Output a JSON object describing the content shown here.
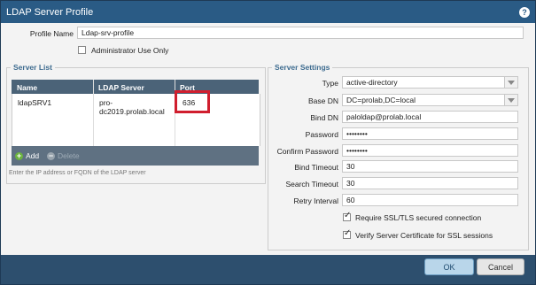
{
  "dialog": {
    "title": "LDAP Server Profile",
    "help_icon": "help-icon"
  },
  "profile": {
    "name_label": "Profile Name",
    "name_value": "Ldap-srv-profile",
    "admin_only_label": "Administrator Use Only",
    "admin_only_checked": false
  },
  "server_list": {
    "legend": "Server List",
    "columns": [
      "Name",
      "LDAP Server",
      "Port"
    ],
    "rows": [
      {
        "name": "ldapSRV1",
        "server_line1": "pro-",
        "server_line2": "dc2019.prolab.local",
        "port": "636"
      }
    ],
    "add_label": "Add",
    "delete_label": "Delete",
    "hint": "Enter the IP address or FQDN of the LDAP server"
  },
  "settings": {
    "legend": "Server Settings",
    "type_label": "Type",
    "type_value": "active-directory",
    "base_dn_label": "Base DN",
    "base_dn_value": "DC=prolab,DC=local",
    "bind_dn_label": "Bind DN",
    "bind_dn_value": "paloldap@prolab.local",
    "password_label": "Password",
    "password_value": "••••••••",
    "confirm_label": "Confirm Password",
    "confirm_value": "••••••••",
    "bind_timeout_label": "Bind Timeout",
    "bind_timeout_value": "30",
    "search_timeout_label": "Search Timeout",
    "search_timeout_value": "30",
    "retry_label": "Retry Interval",
    "retry_value": "60",
    "ssl_label": "Require SSL/TLS secured connection",
    "ssl_checked": true,
    "verify_label": "Verify Server Certificate for SSL sessions",
    "verify_checked": true
  },
  "buttons": {
    "ok": "OK",
    "cancel": "Cancel"
  },
  "colors": {
    "title_bar": "#2a5b85",
    "highlight": "#d01e2e",
    "grid_header": "#4b6378"
  }
}
